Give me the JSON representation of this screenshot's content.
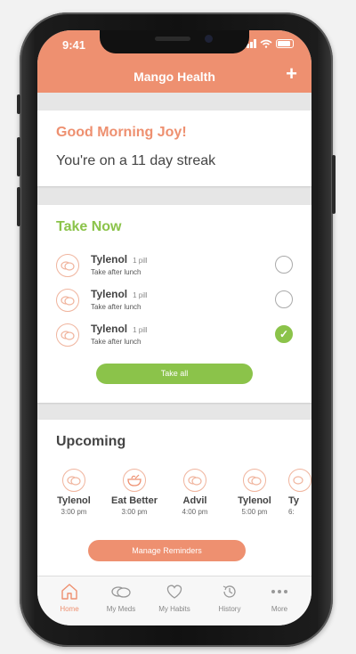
{
  "status_bar": {
    "time": "9:41"
  },
  "header": {
    "title": "Mango Health",
    "add_label": "+"
  },
  "greeting": {
    "title": "Good Morning Joy!",
    "streak": "You're on a 11 day streak"
  },
  "take_now": {
    "title": "Take Now",
    "meds": [
      {
        "name": "Tylenol",
        "dose": "1 pill",
        "instruction": "Take after lunch",
        "taken": false
      },
      {
        "name": "Tylenol",
        "dose": "1 pill",
        "instruction": "Take after lunch",
        "taken": false
      },
      {
        "name": "Tylenol",
        "dose": "1 pill",
        "instruction": "Take after lunch",
        "taken": true
      }
    ],
    "take_all_label": "Take all"
  },
  "upcoming": {
    "title": "Upcoming",
    "items": [
      {
        "name": "Tylenol",
        "time": "3:00 pm",
        "icon": "pill-icon"
      },
      {
        "name": "Eat Better",
        "time": "3:00 pm",
        "icon": "food-bowl-icon"
      },
      {
        "name": "Advil",
        "time": "4:00 pm",
        "icon": "pill-icon"
      },
      {
        "name": "Tylenol",
        "time": "5:00 pm",
        "icon": "pill-icon"
      },
      {
        "name": "Ty",
        "time": "6:",
        "icon": "pill-icon"
      }
    ],
    "manage_label": "Manage Reminders"
  },
  "tabs": [
    {
      "label": "Home",
      "icon": "home-icon",
      "active": true
    },
    {
      "label": "My Meds",
      "icon": "pills-icon",
      "active": false
    },
    {
      "label": "My Habits",
      "icon": "heart-icon",
      "active": false
    },
    {
      "label": "History",
      "icon": "history-icon",
      "active": false
    },
    {
      "label": "More",
      "icon": "more-icon",
      "active": false
    }
  ],
  "colors": {
    "accent": "#ee9070",
    "green": "#8bc34a"
  }
}
